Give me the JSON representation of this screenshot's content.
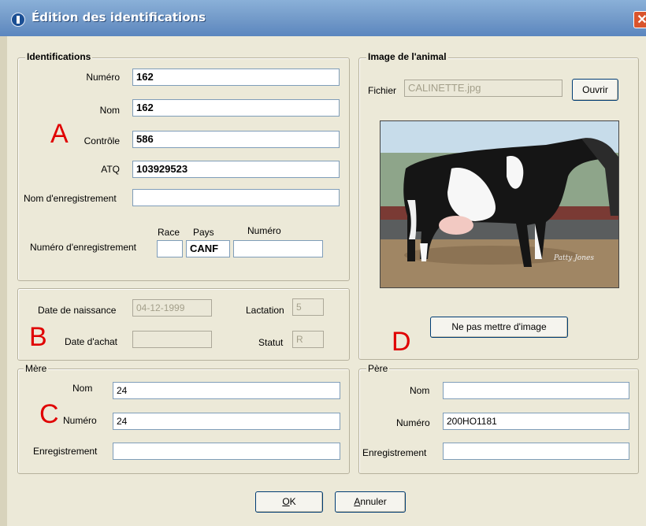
{
  "window": {
    "title": "Édition des identifications",
    "close_symbol": "✕"
  },
  "identifications": {
    "legend": "Identifications",
    "numero_label": "Numéro",
    "numero_value": "162",
    "nom_label": "Nom",
    "nom_value": "162",
    "controle_label": "Contrôle",
    "controle_value": "586",
    "atq_label": "ATQ",
    "atq_value": "103929523",
    "nom_enregistrement_label": "Nom d'enregistrement",
    "nom_enregistrement_value": "",
    "numero_enregistrement_label": "Numéro d'enregistrement",
    "race_label": "Race",
    "race_value": "",
    "pays_label": "Pays",
    "pays_value": "CANF",
    "reg_numero_label": "Numéro",
    "reg_numero_value": ""
  },
  "dates": {
    "date_naissance_label": "Date de naissance",
    "date_naissance_value": "04-12-1999",
    "date_achat_label": "Date d'achat",
    "date_achat_value": "",
    "lactation_label": "Lactation",
    "lactation_value": "5",
    "statut_label": "Statut",
    "statut_value": "R"
  },
  "image": {
    "legend": "Image de l'animal",
    "fichier_label": "Fichier",
    "fichier_value": "CALINETTE.jpg",
    "ouvrir_label": "Ouvrir",
    "photo_watermark": "Patty Jones",
    "no_image_label": "Ne pas mettre d'image"
  },
  "mere": {
    "legend": "Mère",
    "nom_label": "Nom",
    "nom_value": "24",
    "numero_label": "Numéro",
    "numero_value": "24",
    "enregistrement_label": "Enregistrement",
    "enregistrement_value": ""
  },
  "pere": {
    "legend": "Père",
    "nom_label": "Nom",
    "nom_value": "",
    "numero_label": "Numéro",
    "numero_value": "200HO1181",
    "enregistrement_label": "Enregistrement",
    "enregistrement_value": ""
  },
  "annotations": {
    "a": "A",
    "b": "B",
    "c": "C",
    "d": "D"
  },
  "buttons": {
    "ok_mnemonic": "O",
    "ok_rest": "K",
    "annuler_mnemonic": "A",
    "annuler_rest": "nnuler"
  },
  "colors": {
    "annotation_red": "#e00000",
    "title_blue": "#6f97c7",
    "dialog_bg": "#ece9d8"
  }
}
